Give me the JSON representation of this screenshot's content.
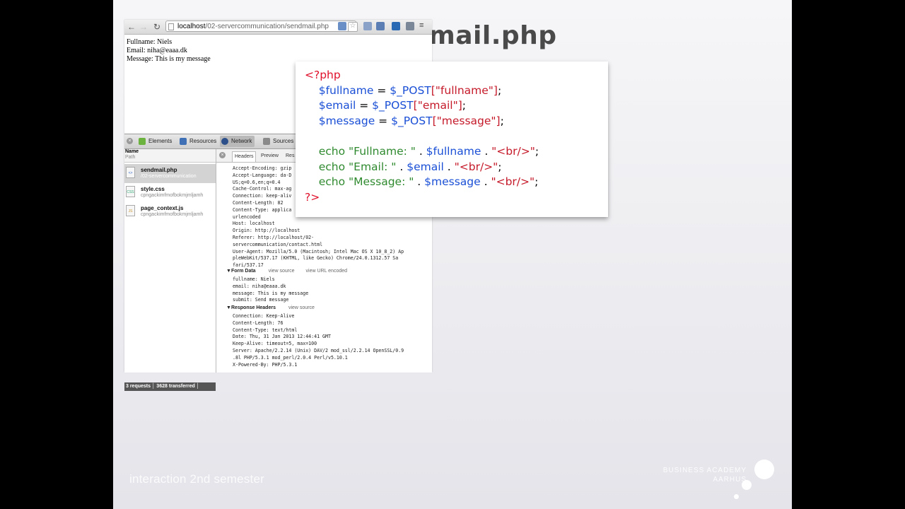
{
  "slide": {
    "title": "sendmail.php",
    "footer_left": "interaction 2nd semester",
    "footer_right_line1": "BUSINESS ACADEMY",
    "footer_right_line2": "AARHUS"
  },
  "browser": {
    "url_host": "localhost",
    "url_path": "/02-servercommunication/sendmail.php",
    "page_lines": [
      "Fullname: Niels",
      "Email: niha@eaaa.dk",
      "Message: This is my message"
    ]
  },
  "devtools": {
    "tabs": [
      "Elements",
      "Resources",
      "Network",
      "Sources"
    ],
    "columns": {
      "name": "Name",
      "path": "Path"
    },
    "requests": [
      {
        "name": "sendmail.php",
        "sub": "/02-servercommunication",
        "icon": "html-icon"
      },
      {
        "name": "style.css",
        "sub": "cpngackimfmofbokmjmljamh",
        "icon": "css-icon"
      },
      {
        "name": "page_context.js",
        "sub": "cpngackimfmofbokmjmljamh",
        "icon": "js-icon"
      }
    ],
    "status": {
      "requests": "3 requests",
      "transferred": "3628 transferred"
    },
    "subtabs": [
      "Headers",
      "Preview",
      "Res"
    ],
    "request_header_lines": [
      "Accept-Encoding: gzip",
      "Accept-Language: da-D",
      "US;q=0.6,en;q=0.4",
      "Cache-Control: max-ag",
      "Connection: keep-aliv",
      "Content-Length: 82",
      "Content-Type: applica",
      "urlencoded",
      "Host: localhost",
      "Origin: http://localhost",
      "Referer: http://localhost/02-",
      "servercommunication/contact.html",
      "User-Agent: Mozilla/5.0 (Macintosh; Intel Mac OS X 10_8_2) Ap",
      "pleWebKit/537.17 (KHTML, like Gecko) Chrome/24.0.1312.57 Sa",
      "fari/537.17"
    ],
    "form_data": {
      "title": "Form Data",
      "view_source": "view source",
      "view_url": "view URL encoded",
      "lines": [
        "fullname: Niels",
        "email: niha@eaaa.dk",
        "message: This is my message",
        "submit: Send message"
      ]
    },
    "response_headers": {
      "title": "Response Headers",
      "view_source": "view source",
      "lines": [
        "Connection: Keep-Alive",
        "Content-Length: 76",
        "Content-Type: text/html",
        "Date: Thu, 31 Jan 2013 12:44:41 GMT",
        "Keep-Alive: timeout=5, max=100",
        "Server: Apache/2.2.14 (Unix) DAV/2 mod_ssl/2.2.14 OpenSSL/0.9",
        ".8l PHP/5.3.1 mod_perl/2.0.4 Perl/v5.10.1",
        "X-Powered-By: PHP/5.3.1"
      ]
    }
  },
  "code": {
    "open_tag": "<?php",
    "l1_var": "$fullname",
    "l1_eq": " = ",
    "l1_post": "$_POST",
    "l1_str": "[\"fullname\"]",
    "l1_end": ";",
    "l2_var": "$email",
    "l2_eq": " = ",
    "l2_post": "$_POST",
    "l2_str": "[\"email\"]",
    "l2_end": ";",
    "l3_var": "$message",
    "l3_eq": " = ",
    "l3_post": "$_POST",
    "l3_str": "[\"message\"]",
    "l3_end": ";",
    "e1_echo": "echo ",
    "e1_str": "\"Fullname: \"",
    "e1_dot1": " . ",
    "e1_var": "$fullname",
    "e1_dot2": " . ",
    "e1_br": "\"<br/>\"",
    "e1_end": ";",
    "e2_echo": "echo ",
    "e2_str": "\"Email: \"",
    "e2_dot1": " . ",
    "e2_var": "$email",
    "e2_dot2": " . ",
    "e2_br": "\"<br/>\"",
    "e2_end": ";",
    "e3_echo": "echo ",
    "e3_str": "\"Message: \"",
    "e3_dot1": " . ",
    "e3_var": "$message",
    "e3_dot2": " . ",
    "e3_br": "\"<br/>\"",
    "e3_end": ";",
    "close_tag": "?>"
  },
  "colors": {
    "keyword_red": "#e0102b",
    "variable_blue": "#1a4fd6",
    "echo_green": "#2f8a2f"
  }
}
